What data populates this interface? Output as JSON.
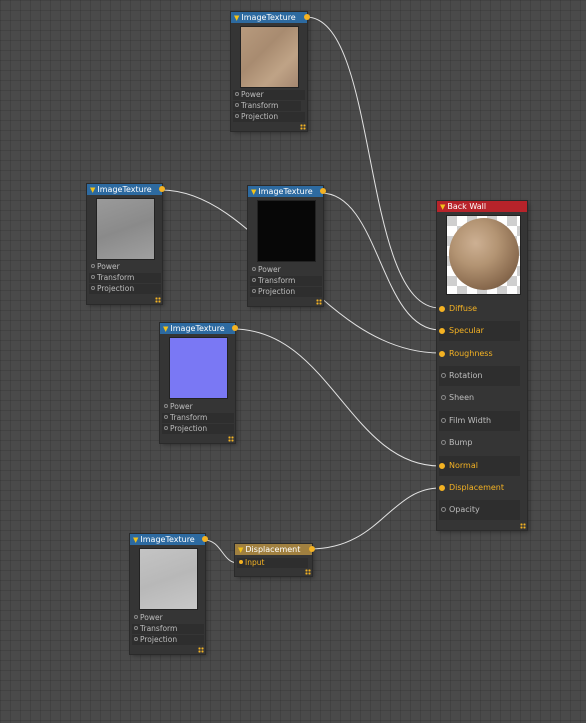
{
  "nodes": {
    "tex_top": {
      "title": "ImageTexture",
      "rows": [
        "Power",
        "Transform",
        "Projection"
      ]
    },
    "tex_left": {
      "title": "ImageTexture",
      "rows": [
        "Power",
        "Transform",
        "Projection"
      ]
    },
    "tex_mid": {
      "title": "ImageTexture",
      "rows": [
        "Power",
        "Transform",
        "Projection"
      ]
    },
    "tex_normal": {
      "title": "ImageTexture",
      "rows": [
        "Power",
        "Transform",
        "Projection"
      ]
    },
    "tex_bottom": {
      "title": "ImageTexture",
      "rows": [
        "Power",
        "Transform",
        "Projection"
      ]
    },
    "displacement": {
      "title": "Displacement",
      "input_label": "Input"
    },
    "material": {
      "title": "Back Wall",
      "inputs": [
        "Diffuse",
        "Specular",
        "Roughness",
        "Rotation",
        "Sheen",
        "Film Width",
        "Bump",
        "Normal",
        "Displacement",
        "Opacity"
      ],
      "connected": [
        "Diffuse",
        "Specular",
        "Roughness",
        "Normal",
        "Displacement"
      ]
    }
  },
  "colors": {
    "canvas": "#4a4a4a",
    "texture_header": "#2d6aa0",
    "material_header": "#b7232a",
    "displacement_header": "#a08040",
    "port_active": "#f4b223",
    "wire": "#e6e6e6"
  },
  "icons": {
    "collapse": "triangle-down-icon",
    "resize": "resize-grip-icon"
  }
}
